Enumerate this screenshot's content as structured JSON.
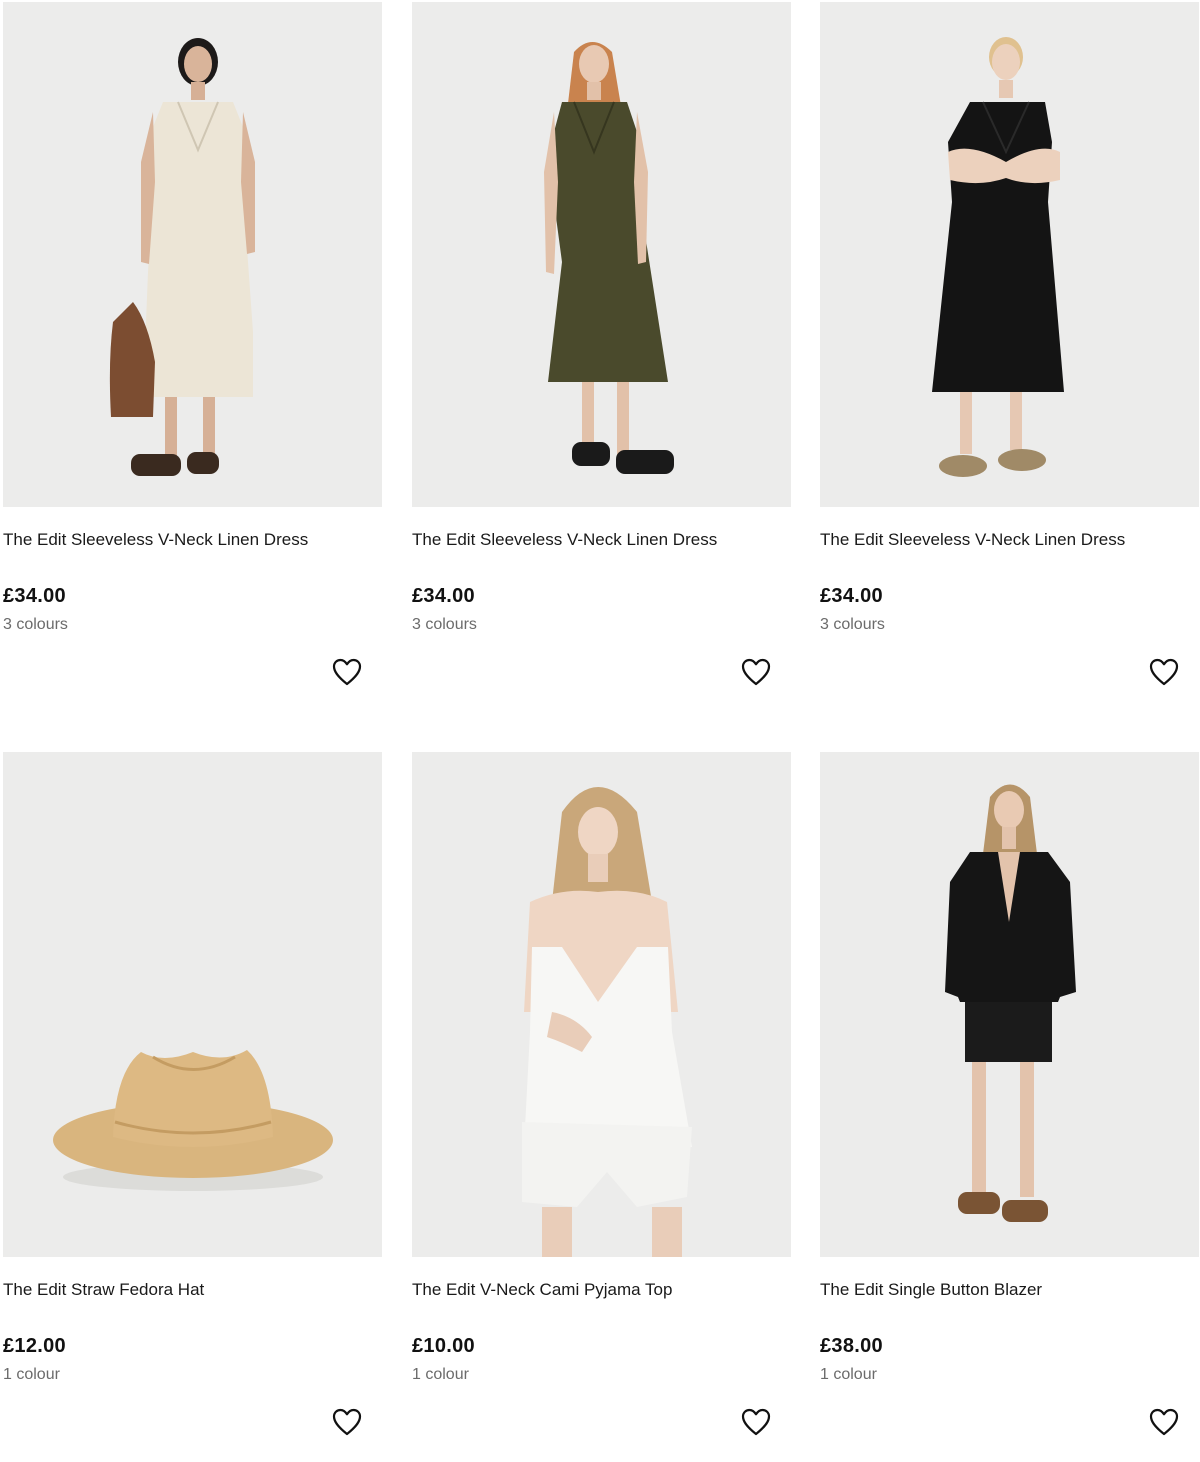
{
  "products": [
    {
      "name": "The Edit Sleeveless V-Neck Linen Dress",
      "price": "£34.00",
      "colours": "3 colours",
      "image": "cream-linen-dress",
      "dress_color": "#ece5d6"
    },
    {
      "name": "The Edit Sleeveless V-Neck Linen Dress",
      "price": "£34.00",
      "colours": "3 colours",
      "image": "khaki-linen-dress",
      "dress_color": "#4a4a2c"
    },
    {
      "name": "The Edit Sleeveless V-Neck Linen Dress",
      "price": "£34.00",
      "colours": "3 colours",
      "image": "black-linen-dress",
      "dress_color": "#141414"
    },
    {
      "name": "The Edit Straw Fedora Hat",
      "price": "£12.00",
      "colours": "1 colour",
      "image": "straw-fedora-hat",
      "dress_color": "#d9b57e"
    },
    {
      "name": "The Edit V-Neck Cami Pyjama Top",
      "price": "£10.00",
      "colours": "1 colour",
      "image": "white-cami-pyjama",
      "dress_color": "#f7f7f5"
    },
    {
      "name": "The Edit Single Button Blazer",
      "price": "£38.00",
      "colours": "1 colour",
      "image": "black-blazer",
      "dress_color": "#151515"
    }
  ],
  "wishlist_icon": "heart-outline-icon"
}
